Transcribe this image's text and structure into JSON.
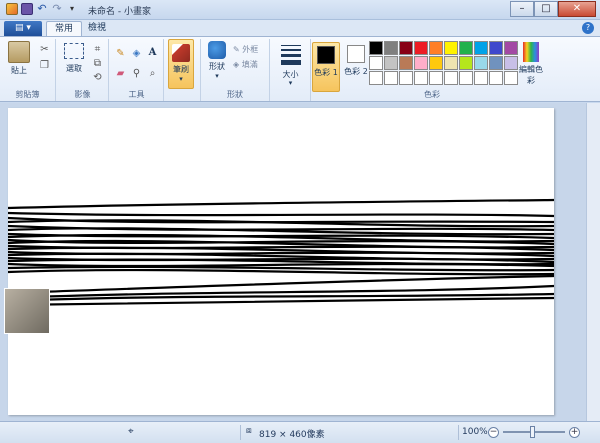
{
  "window": {
    "title": "未命名 - 小畫家",
    "minimize": "–",
    "maximize": "□",
    "close": "✕"
  },
  "tabs": {
    "app_menu": "▤ ▾",
    "home": "常用",
    "view": "檢視",
    "help": "?"
  },
  "ribbon": {
    "clipboard": {
      "label": "剪貼簿",
      "paste": "貼上"
    },
    "image": {
      "label": "影像",
      "select": "選取"
    },
    "tools": {
      "label": "工具",
      "text": "A"
    },
    "brushes": {
      "label": "筆刷"
    },
    "shapes": {
      "label": "形狀",
      "shapes_btn": "形狀",
      "outline": "外框",
      "fill": "填滿"
    },
    "size": {
      "label": "大小"
    },
    "colors": {
      "label": "色彩",
      "color1": "色彩 1",
      "color2": "色彩 2",
      "edit": "編輯色彩",
      "color1_value": "#000000",
      "color2_value": "#ffffff",
      "palette": [
        "#000000",
        "#7f7f7f",
        "#880015",
        "#ed1c24",
        "#ff7f27",
        "#fff200",
        "#22b14c",
        "#00a2e8",
        "#3f48cc",
        "#a349a4",
        "#ffffff",
        "#c3c3c3",
        "#b97a57",
        "#ffaec9",
        "#ffc90e",
        "#efe4b0",
        "#b5e61d",
        "#99d9ea",
        "#7092be",
        "#c8bfe7",
        "#ffffff",
        "#ffffff",
        "#ffffff",
        "#ffffff",
        "#ffffff",
        "#ffffff",
        "#ffffff",
        "#ffffff",
        "#ffffff",
        "#ffffff"
      ]
    }
  },
  "status": {
    "dimensions": "819 × 460像素",
    "zoom": "100%",
    "zoom_out": "−",
    "zoom_in": "+"
  }
}
